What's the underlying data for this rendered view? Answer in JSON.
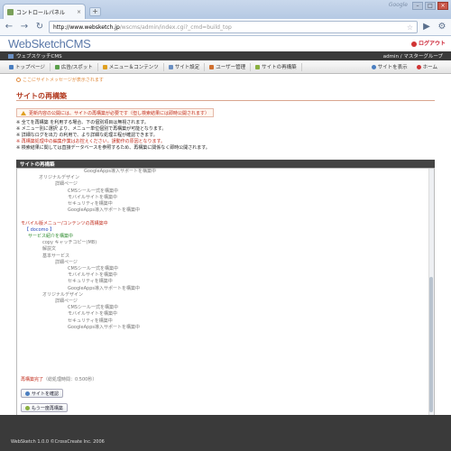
{
  "browser": {
    "tab_title": "コントロールパネル",
    "tab_close": "×",
    "new_tab": "+",
    "brand": "Google",
    "url_host": "http://www.websketch.jp",
    "url_path": "/wscms/admin/index.cgi?_cmd=build_top",
    "back": "←",
    "forward": "→",
    "reload": "↻",
    "star": "☆"
  },
  "site": {
    "logo": "WebSketchCMS",
    "logout": "ログアウト",
    "site_name": "ウェブスケッチCMS",
    "user": "admin / マスターグループ",
    "menu": [
      {
        "label": "トップページ",
        "color": "#4a7ec0"
      },
      {
        "label": "広告/スポット",
        "color": "#5aa04a"
      },
      {
        "label": "メニュー＆コンテンツ",
        "color": "#e0a020"
      },
      {
        "label": "サイト設定",
        "color": "#6a8fc2"
      },
      {
        "label": "ユーザー管理",
        "color": "#d07030"
      },
      {
        "label": "サイトの再構築",
        "color": "#8ab040"
      }
    ],
    "menu_right": [
      {
        "label": "サイトを表示",
        "color": "#4a7ec0"
      },
      {
        "label": "ホーム",
        "color": "#d03434"
      }
    ],
    "notice": "ここにサイトメッセージが表示されます"
  },
  "page": {
    "title": "サイトの再構築",
    "warning": "更新内容の公開には、サイトの再構築が必要です（但し検索結果には即時公開されます）",
    "notes": [
      {
        "text": "※ 全てを再構築 を利用する場合、下の個別項目は無視されます。",
        "red": false
      },
      {
        "text": "※ メニュー別に選択 より、メニュー単位個別で再構築が可能となります。",
        "red": false
      },
      {
        "text": "※ 詳細なログを出力 の利用で、より詳細な処理工程が確認できます。",
        "red": false
      },
      {
        "text": "※ 再構築処理中の編集作業はお控えください。誤動作の原因となります。",
        "red": true
      },
      {
        "text": "※ 検索結果に関しては直接データベースを参照するため、再構築に関係なく即時公開されます。",
        "red": false
      }
    ],
    "panel_title": "サイトの再構築",
    "log": [
      {
        "indent": 70,
        "text": "GoogleApps導入サポートを構築中",
        "cls": ""
      },
      {
        "indent": 20,
        "text": "オリジナルデザイン",
        "cls": ""
      },
      {
        "indent": 38,
        "text": "詳細ページ",
        "cls": ""
      },
      {
        "indent": 52,
        "text": "CMSシール一式を構築中",
        "cls": ""
      },
      {
        "indent": 52,
        "text": "モバイルサイトを構築中",
        "cls": ""
      },
      {
        "indent": 52,
        "text": "セキュリティを構築中",
        "cls": ""
      },
      {
        "indent": 52,
        "text": "GoogleApps導入サポートを構築中",
        "cls": ""
      },
      {
        "indent": 0,
        "text": "",
        "cls": ""
      },
      {
        "indent": 0,
        "text": "モバイル版メニュー/コンテンツの再構築中",
        "cls": "red"
      },
      {
        "indent": 4,
        "text": "【 docomo 】",
        "cls": "blue"
      },
      {
        "indent": 8,
        "text": "サービス紹介を構築中",
        "cls": "green"
      },
      {
        "indent": 24,
        "text": "copy キャッチコピー(MB)",
        "cls": ""
      },
      {
        "indent": 24,
        "text": "解説文",
        "cls": ""
      },
      {
        "indent": 24,
        "text": "基本サービス",
        "cls": ""
      },
      {
        "indent": 38,
        "text": "詳細ページ",
        "cls": ""
      },
      {
        "indent": 52,
        "text": "CMSシール一式を構築中",
        "cls": ""
      },
      {
        "indent": 52,
        "text": "モバイルサイトを構築中",
        "cls": ""
      },
      {
        "indent": 52,
        "text": "セキュリティを構築中",
        "cls": ""
      },
      {
        "indent": 52,
        "text": "GoogleApps導入サポートを構築中",
        "cls": ""
      },
      {
        "indent": 24,
        "text": "オリジナルデザイン",
        "cls": ""
      },
      {
        "indent": 38,
        "text": "詳細ページ",
        "cls": ""
      },
      {
        "indent": 52,
        "text": "CMSシール一式を構築中",
        "cls": ""
      },
      {
        "indent": 52,
        "text": "モバイルサイトを構築中",
        "cls": ""
      },
      {
        "indent": 52,
        "text": "セキュリティを構築中",
        "cls": ""
      },
      {
        "indent": 52,
        "text": "GoogleApps導入サポートを構築中",
        "cls": ""
      }
    ],
    "done_label": "再構築完了",
    "done_detail": "（総処理時間：0.500秒）",
    "btn_view_site": "サイトを確認",
    "btn_rebuild_again": "もう一度再構築"
  },
  "footer": "WebSketch 1.0.0 ©CrossCreate Inc. 2006"
}
